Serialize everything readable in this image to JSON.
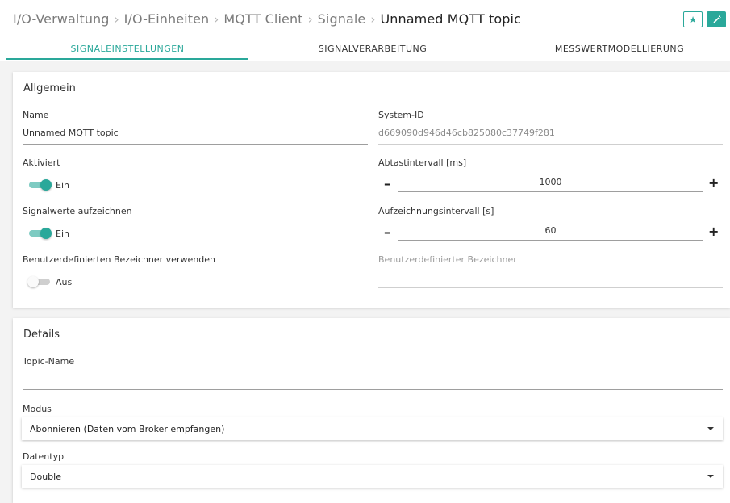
{
  "breadcrumb": {
    "items": [
      "I/O-Verwaltung",
      "I/O-Einheiten",
      "MQTT Client",
      "Signale"
    ],
    "separator": "›",
    "current": "Unnamed MQTT topic"
  },
  "header_buttons": {
    "favorite_icon": "star-icon",
    "wizard_icon": "magic-wand-icon",
    "accent_color": "#2aa89a"
  },
  "tabs": [
    {
      "label": "SIGNALEINSTELLUNGEN",
      "active": true
    },
    {
      "label": "SIGNALVERARBEITUNG",
      "active": false
    },
    {
      "label": "MESSWERTMODELLIERUNG",
      "active": false
    }
  ],
  "general": {
    "title": "Allgemein",
    "name": {
      "label": "Name",
      "value": "Unnamed MQTT topic"
    },
    "system_id": {
      "label": "System-ID",
      "value": "d669090d946d46cb825080c37749f281"
    },
    "enabled": {
      "label": "Aktiviert",
      "state": "Ein",
      "on": true
    },
    "sampling": {
      "label": "Abtastintervall [ms]",
      "value": "1000",
      "minus": "–",
      "plus": "+"
    },
    "record": {
      "label": "Signalwerte aufzeichnen",
      "state": "Ein",
      "on": true
    },
    "record_interval": {
      "label": "Aufzeichnungsintervall [s]",
      "value": "60",
      "minus": "–",
      "plus": "+"
    },
    "custom_id_toggle": {
      "label": "Benutzerdefinierten Bezeichner verwenden",
      "state": "Aus",
      "on": false
    },
    "custom_id": {
      "placeholder": "Benutzerdefinierter Bezeichner",
      "value": ""
    }
  },
  "details": {
    "title": "Details",
    "topic": {
      "label": "Topic-Name",
      "value": ""
    },
    "mode": {
      "label": "Modus",
      "value": "Abonnieren (Daten vom Broker empfangen)"
    },
    "datatype": {
      "label": "Datentyp",
      "value": "Double"
    }
  }
}
